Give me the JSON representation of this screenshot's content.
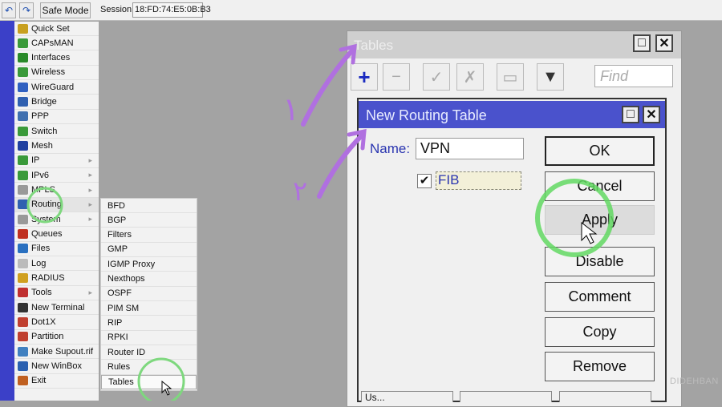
{
  "toolbar": {
    "undo_icon": "undo-icon",
    "redo_icon": "redo-icon",
    "safe_mode": "Safe Mode",
    "session_label": "Session:",
    "session_value": "18:FD:74:E5:0B:B3"
  },
  "sidebar": {
    "items": [
      {
        "label": "Quick Set",
        "color": "#c8a020"
      },
      {
        "label": "CAPsMAN",
        "color": "#3a9a3a"
      },
      {
        "label": "Interfaces",
        "color": "#2a8a2a"
      },
      {
        "label": "Wireless",
        "color": "#3a9a3a"
      },
      {
        "label": "WireGuard",
        "color": "#3060c0"
      },
      {
        "label": "Bridge",
        "color": "#3060b0"
      },
      {
        "label": "PPP",
        "color": "#4070b0"
      },
      {
        "label": "Switch",
        "color": "#3a9a3a"
      },
      {
        "label": "Mesh",
        "color": "#2040a0"
      },
      {
        "label": "IP",
        "color": "#3a9a3a",
        "submenu": true
      },
      {
        "label": "IPv6",
        "color": "#3a9a3a",
        "submenu": true
      },
      {
        "label": "MPLS",
        "color": "#999",
        "submenu": true
      },
      {
        "label": "Routing",
        "color": "#3060b0",
        "submenu": true
      },
      {
        "label": "System",
        "color": "#999",
        "submenu": true
      },
      {
        "label": "Queues",
        "color": "#c03020"
      },
      {
        "label": "Files",
        "color": "#2a70c0"
      },
      {
        "label": "Log",
        "color": "#bbb"
      },
      {
        "label": "RADIUS",
        "color": "#d0a020"
      },
      {
        "label": "Tools",
        "color": "#c03030",
        "submenu": true
      },
      {
        "label": "New Terminal",
        "color": "#333"
      },
      {
        "label": "Dot1X",
        "color": "#c04030"
      },
      {
        "label": "Partition",
        "color": "#c04030"
      },
      {
        "label": "Make Supout.rif",
        "color": "#4080c0"
      },
      {
        "label": "New WinBox",
        "color": "#2a60b0"
      },
      {
        "label": "Exit",
        "color": "#c06020"
      }
    ]
  },
  "submenu": {
    "items": [
      "BFD",
      "BGP",
      "Filters",
      "GMP",
      "IGMP Proxy",
      "Nexthops",
      "OSPF",
      "PIM SM",
      "RIP",
      "RPKI",
      "Router ID",
      "Rules",
      "Tables"
    ]
  },
  "tables_window": {
    "title": "Tables",
    "find_placeholder": "Find",
    "bottom_tabs": [
      "Us...",
      "",
      ""
    ]
  },
  "dialog": {
    "title": "New Routing Table",
    "name_label": "Name:",
    "name_value": "VPN",
    "fib_label": "FIB",
    "fib_checked": true,
    "buttons": [
      "OK",
      "Cancel",
      "Apply",
      "Disable",
      "Comment",
      "Copy",
      "Remove"
    ]
  },
  "annotations": {
    "step1": "۱",
    "step2": "۲",
    "arrow_color": "#b070e0",
    "circle_color": "#7ed87e"
  },
  "watermark": "DIDEHBAN"
}
